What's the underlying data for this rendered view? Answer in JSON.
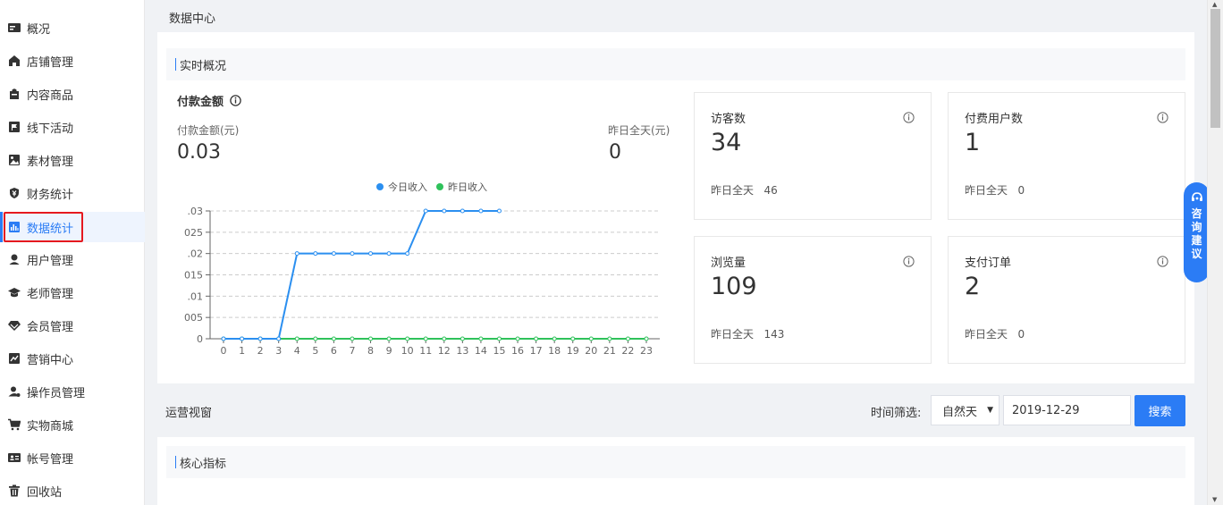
{
  "sidebar": {
    "items": [
      {
        "label": "概况",
        "icon": "card-icon"
      },
      {
        "label": "店铺管理",
        "icon": "home-icon"
      },
      {
        "label": "内容商品",
        "icon": "bag-icon"
      },
      {
        "label": "线下活动",
        "icon": "flag-icon"
      },
      {
        "label": "素材管理",
        "icon": "image-icon"
      },
      {
        "label": "财务统计",
        "icon": "yuan-shield-icon"
      },
      {
        "label": "数据统计",
        "icon": "bar-chart-icon",
        "active": true
      },
      {
        "label": "用户管理",
        "icon": "user-icon"
      },
      {
        "label": "老师管理",
        "icon": "graduation-cap-icon"
      },
      {
        "label": "会员管理",
        "icon": "diamond-icon"
      },
      {
        "label": "营销中心",
        "icon": "trend-chart-icon"
      },
      {
        "label": "操作员管理",
        "icon": "user-gear-icon"
      },
      {
        "label": "实物商城",
        "icon": "cart-icon"
      },
      {
        "label": "帐号管理",
        "icon": "id-card-icon"
      },
      {
        "label": "回收站",
        "icon": "trash-icon"
      }
    ]
  },
  "header": {
    "title": "数据中心"
  },
  "realtime": {
    "section_title": "实时概况",
    "pay_title": "付款金额",
    "pay_label": "付款金额(元)",
    "pay_value": "0.03",
    "yesterday_label": "昨日全天(元)",
    "yesterday_value": "0",
    "cards": [
      {
        "label": "访客数",
        "value": "34",
        "yesterday_label": "昨日全天",
        "yesterday_value": "46"
      },
      {
        "label": "付费用户数",
        "value": "1",
        "yesterday_label": "昨日全天",
        "yesterday_value": "0"
      },
      {
        "label": "浏览量",
        "value": "109",
        "yesterday_label": "昨日全天",
        "yesterday_value": "143"
      },
      {
        "label": "支付订单",
        "value": "2",
        "yesterday_label": "昨日全天",
        "yesterday_value": "0"
      }
    ]
  },
  "chart_data": {
    "type": "line",
    "x": [
      0,
      1,
      2,
      3,
      4,
      5,
      6,
      7,
      8,
      9,
      10,
      11,
      12,
      13,
      14,
      15,
      16,
      17,
      18,
      19,
      20,
      21,
      22,
      23
    ],
    "y_ticks": [
      0,
      0.005,
      0.01,
      0.015,
      0.02,
      0.025,
      0.03
    ],
    "y_tick_labels": [
      "0",
      "005",
      ".01",
      "015",
      ".02",
      "025",
      ".03"
    ],
    "ylim": [
      0,
      0.03
    ],
    "grid": true,
    "legend_position": "top",
    "series": [
      {
        "name": "今日收入",
        "color": "#2b8ff0",
        "x": [
          0,
          1,
          2,
          3,
          4,
          5,
          6,
          7,
          8,
          9,
          10,
          11,
          12,
          13,
          14,
          15
        ],
        "values": [
          0,
          0,
          0,
          0,
          0.02,
          0.02,
          0.02,
          0.02,
          0.02,
          0.02,
          0.02,
          0.03,
          0.03,
          0.03,
          0.03,
          0.03
        ]
      },
      {
        "name": "昨日收入",
        "color": "#2fc25b",
        "x": [
          0,
          1,
          2,
          3,
          4,
          5,
          6,
          7,
          8,
          9,
          10,
          11,
          12,
          13,
          14,
          15,
          16,
          17,
          18,
          19,
          20,
          21,
          22,
          23
        ],
        "values": [
          0,
          0,
          0,
          0,
          0,
          0,
          0,
          0,
          0,
          0,
          0,
          0,
          0,
          0,
          0,
          0,
          0,
          0,
          0,
          0,
          0,
          0,
          0,
          0
        ]
      }
    ]
  },
  "operations": {
    "title": "运营视窗",
    "filter_label": "时间筛选:",
    "select_value": "自然天",
    "date_value": "2019-12-29",
    "search_label": "搜索"
  },
  "core": {
    "section_title": "核心指标"
  },
  "consult": {
    "chars": [
      "咨",
      "询",
      "建",
      "议"
    ]
  },
  "colors": {
    "accent": "#2b7cf5",
    "today": "#2b8ff0",
    "yesterday": "#2fc25b",
    "highlight": "#e5191f"
  }
}
